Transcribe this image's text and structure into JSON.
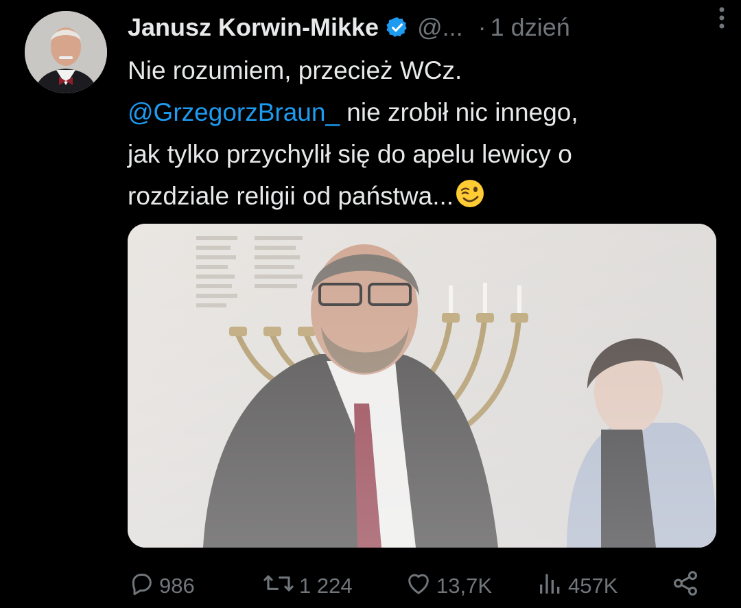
{
  "tweet": {
    "author": {
      "display_name": "Janusz Korwin-Mikke",
      "handle": "@...",
      "verified": true
    },
    "separator": "·",
    "timestamp": "1 dzień",
    "text": {
      "line1": "Nie rozumiem, przecież WCz.",
      "mention": "@GrzegorzBraun_",
      "line2_rest": " nie zrobił nic innego,",
      "line3": "jak tylko przychylił się do apelu lewicy o",
      "line4": "rozdziale religii od państwa...",
      "emoji": "winking-face"
    },
    "stats": {
      "replies": "986",
      "reposts": "1 224",
      "likes": "13,7K",
      "views": "457K"
    }
  },
  "colors": {
    "background": "#000000",
    "text": "#e7e9ea",
    "secondary": "#71767b",
    "link": "#1d9bf0",
    "verified_badge": "#1d9bf0"
  },
  "icons": [
    "verified-badge-icon",
    "more-options-icon",
    "reply-icon",
    "repost-icon",
    "like-icon",
    "views-icon",
    "share-icon"
  ]
}
